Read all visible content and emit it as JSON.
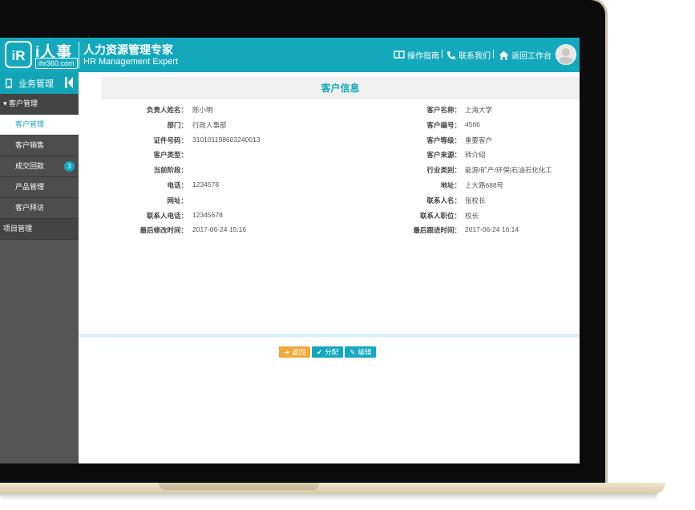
{
  "header": {
    "logo_mark": "iR",
    "logo_name": "i人事",
    "logo_url": "ihr360.com",
    "slogan": "人力资源管理专家",
    "slogan_en": "HR Management Expert",
    "links": {
      "guide": "操作指南",
      "contact": "联系我们",
      "workbench": "返回工作台"
    },
    "separator": "|"
  },
  "sidebar": {
    "title": "业务管理",
    "groups": [
      {
        "label": "客户管理",
        "items": [
          {
            "label": "客户管理",
            "active": true
          },
          {
            "label": "客户销售"
          },
          {
            "label": "成交回款",
            "badge": "3"
          },
          {
            "label": "产品管理"
          },
          {
            "label": "客户拜访"
          }
        ]
      },
      {
        "label": "项目管理"
      }
    ]
  },
  "panel": {
    "title": "客户信息",
    "left": [
      {
        "label": "负责人姓名：",
        "value": "陈小明"
      },
      {
        "label": "部门：",
        "value": "行政人事部"
      },
      {
        "label": "证件号码：",
        "value": "310101198603240013"
      },
      {
        "label": "客户类型：",
        "value": ""
      },
      {
        "label": "当前阶段：",
        "value": ""
      },
      {
        "label": "电话：",
        "value": "1234578"
      },
      {
        "label": "网址：",
        "value": ""
      },
      {
        "label": "联系人电话：",
        "value": "12345678"
      },
      {
        "label": "最后修改时间：",
        "value": "2017-06-24 15:16"
      }
    ],
    "right": [
      {
        "label": "客户名称：",
        "value": "上海大学"
      },
      {
        "label": "客户编号：",
        "value": "4566"
      },
      {
        "label": "客户等级：",
        "value": "重要客户"
      },
      {
        "label": "客户来源：",
        "value": "转介绍"
      },
      {
        "label": "行业类别：",
        "value": "能源/矿产/环保|石油石化化工"
      },
      {
        "label": "地址：",
        "value": "上大路688号"
      },
      {
        "label": "联系人名：",
        "value": "张校长"
      },
      {
        "label": "联系人职位：",
        "value": "校长"
      },
      {
        "label": "最后跟进时间：",
        "value": "2017-06-24 16:14"
      }
    ],
    "buttons": {
      "back": "返回",
      "assign": "分配",
      "edit": "编辑"
    }
  }
}
